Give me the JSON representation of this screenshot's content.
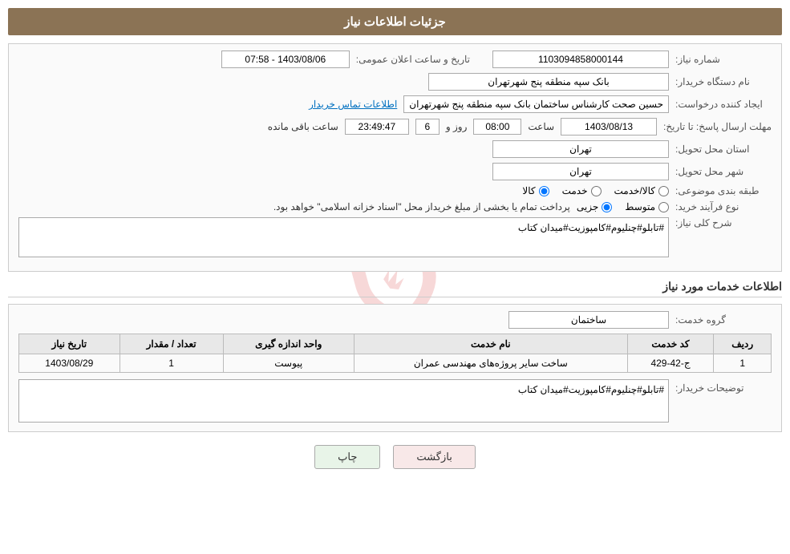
{
  "header": {
    "title": "جزئیات اطلاعات نیاز"
  },
  "fields": {
    "need_number_label": "شماره نیاز:",
    "need_number_value": "1103094858000144",
    "buyer_station_label": "نام دستگاه خریدار:",
    "buyer_station_value": "بانک سپه منطقه پنج شهرتهران",
    "announcement_label": "تاریخ و ساعت اعلان عمومی:",
    "announcement_value": "1403/08/06 - 07:58",
    "creator_label": "ایجاد کننده درخواست:",
    "creator_value": "حسین صحت کارشناس ساختمان بانک سپه منطقه پنج شهرتهران",
    "contact_link": "اطلاعات تماس خریدار",
    "send_deadline_label": "مهلت ارسال پاسخ: تا تاریخ:",
    "send_date_value": "1403/08/13",
    "send_time_label": "ساعت",
    "send_time_value": "08:00",
    "send_days_label": "روز و",
    "send_days_value": "6",
    "remaining_label": "ساعت باقی مانده",
    "remaining_value": "23:49:47",
    "delivery_province_label": "استان محل تحویل:",
    "delivery_province_value": "تهران",
    "delivery_city_label": "شهر محل تحویل:",
    "delivery_city_value": "تهران",
    "category_label": "طبقه بندی موضوعی:",
    "category_option1": "کالا",
    "category_option2": "خدمت",
    "category_option3": "کالا/خدمت",
    "process_label": "نوع فرآیند خرید:",
    "process_option1": "جزیی",
    "process_option2": "متوسط",
    "payment_note": "پرداخت تمام یا بخشی از مبلغ خریداز محل \"اسناد خزانه اسلامی\" خواهد بود.",
    "need_description_label": "شرح کلی نیاز:",
    "need_description_value": "#تابلو#چنلیوم#کامپوزیت#میدان کتاب",
    "services_section_title": "اطلاعات خدمات مورد نیاز",
    "service_group_label": "گروه خدمت:",
    "service_group_value": "ساختمان",
    "table": {
      "col_row": "ردیف",
      "col_code": "کد خدمت",
      "col_name": "نام خدمت",
      "col_unit": "واحد اندازه گیری",
      "col_qty": "تعداد / مقدار",
      "col_date": "تاریخ نیاز",
      "rows": [
        {
          "row": "1",
          "code": "ج-42-429",
          "name": "ساخت سایر پروژه‌های مهندسی عمران",
          "unit": "پیوست",
          "qty": "1",
          "date": "1403/08/29"
        }
      ]
    },
    "buyer_desc_label": "توضیحات خریدار:",
    "buyer_desc_value": "#تابلو#چنلیوم#کامپوزیت#میدان کتاب"
  },
  "buttons": {
    "print_label": "چاپ",
    "back_label": "بازگشت"
  }
}
